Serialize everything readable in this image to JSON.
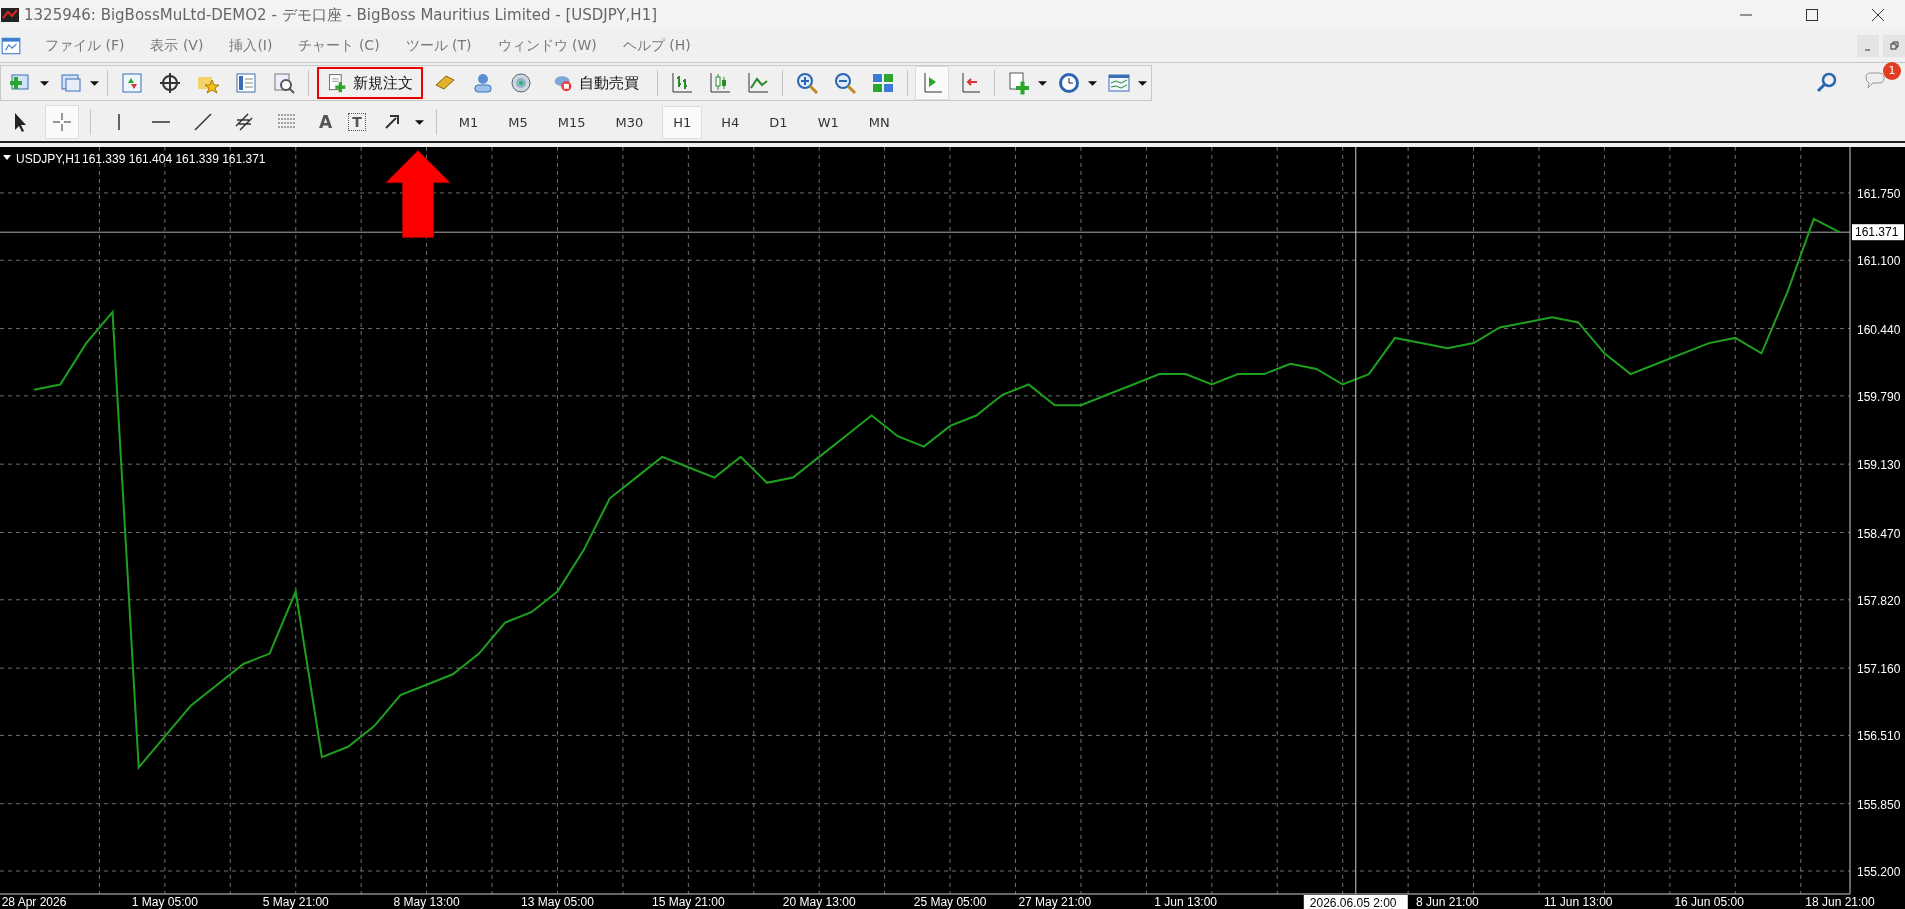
{
  "window": {
    "title": "1325946: BigBossMuLtd-DEMO2 - デモ口座 - BigBoss Mauritius Limited - [USDJPY,H1]"
  },
  "menu": [
    "ファイル (F)",
    "表示 (V)",
    "挿入(I)",
    "チャート (C)",
    "ツール (T)",
    "ウィンドウ (W)",
    "ヘルプ (H)"
  ],
  "toolbar": {
    "order_button": {
      "label": "新規注文",
      "highlighted": true
    },
    "autotrade_button": {
      "label": "自動売買"
    },
    "notification_count": "1"
  },
  "drawing_tools": {
    "text_tool": "A",
    "label_tool": "T"
  },
  "timeframes": [
    {
      "label": "M1",
      "selected": false
    },
    {
      "label": "M5",
      "selected": false
    },
    {
      "label": "M15",
      "selected": false
    },
    {
      "label": "M30",
      "selected": false
    },
    {
      "label": "H1",
      "selected": true
    },
    {
      "label": "H4",
      "selected": false
    },
    {
      "label": "D1",
      "selected": false
    },
    {
      "label": "W1",
      "selected": false
    },
    {
      "label": "MN",
      "selected": false
    }
  ],
  "chart": {
    "legend": "USDJPY,H1",
    "ohlc": "161.339 161.404 161.339 161.371",
    "current_price": "161.371",
    "crosshair_label": "2026.06.05 2:00",
    "chart_data": {
      "type": "line",
      "grid": true,
      "ref_lines": [
        {
          "axis": "y",
          "value": 161.371
        }
      ],
      "categories": [
        "28 Apr 2026",
        null,
        null,
        null,
        null,
        "1 May 05:00",
        null,
        null,
        null,
        null,
        "5 May 21:00",
        null,
        null,
        null,
        null,
        "8 May 13:00",
        null,
        null,
        null,
        null,
        "13 May 05:00",
        null,
        null,
        null,
        null,
        "15 May 21:00",
        null,
        null,
        null,
        null,
        "20 May 13:00",
        null,
        null,
        null,
        null,
        "25 May 05:00",
        null,
        null,
        null,
        "27 May 21:00",
        null,
        null,
        null,
        null,
        "1 Jun 13:00",
        null,
        null,
        null,
        null,
        null,
        null,
        null,
        null,
        null,
        "8 Jun 21:00",
        null,
        null,
        null,
        null,
        "11 Jun 13:00",
        null,
        null,
        null,
        null,
        "16 Jun 05:00",
        null,
        null,
        null,
        null,
        "18 Jun 21:00"
      ],
      "series": [
        {
          "color": "#1ea01e",
          "values": [
            159.85,
            159.9,
            160.3,
            160.6,
            156.2,
            156.5,
            156.8,
            157.0,
            157.2,
            157.3,
            157.9,
            156.3,
            156.4,
            156.6,
            156.9,
            157.0,
            157.1,
            157.3,
            157.6,
            157.7,
            157.9,
            158.3,
            158.8,
            159.0,
            159.2,
            159.1,
            159.0,
            159.2,
            158.95,
            159.0,
            159.2,
            159.4,
            159.6,
            159.4,
            159.3,
            159.5,
            159.6,
            159.8,
            159.9,
            159.7,
            159.7,
            159.8,
            159.9,
            160.0,
            160.0,
            159.9,
            160.0,
            160.0,
            160.1,
            160.05,
            159.9,
            160.0,
            160.35,
            160.3,
            160.25,
            160.3,
            160.45,
            160.5,
            160.55,
            160.5,
            160.2,
            160.0,
            160.1,
            160.2,
            160.3,
            160.35,
            160.2,
            160.8,
            161.5,
            161.37
          ]
        }
      ],
      "ylim": [
        154.978,
        162.194
      ],
      "yticks": [
        {
          "value": 155.2,
          "label": "155.200"
        },
        {
          "value": 155.85,
          "label": "155.850"
        },
        {
          "value": 156.51,
          "label": "156.510"
        },
        {
          "value": 157.16,
          "label": "157.160"
        },
        {
          "value": 157.82,
          "label": "157.820"
        },
        {
          "value": 158.47,
          "label": "158.470"
        },
        {
          "value": 159.13,
          "label": "159.130"
        },
        {
          "value": 159.79,
          "label": "159.790"
        },
        {
          "value": 160.44,
          "label": "160.440"
        },
        {
          "value": 161.1,
          "label": "161.100"
        },
        {
          "value": 161.75,
          "label": "161.750"
        }
      ]
    }
  }
}
